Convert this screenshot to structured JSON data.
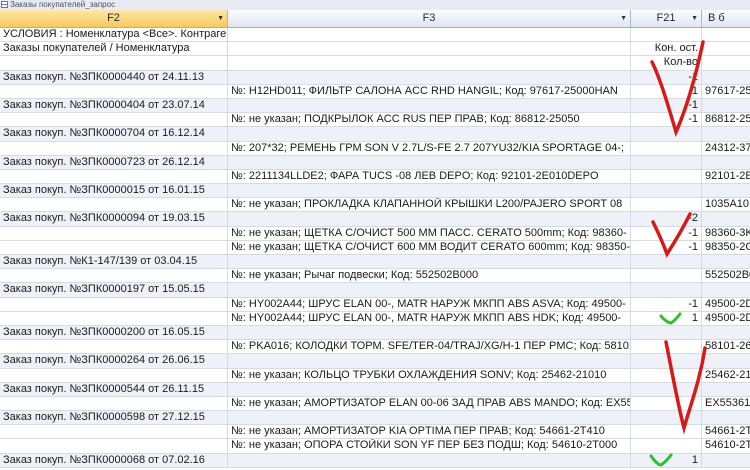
{
  "window": {
    "title": "Заказы покупателей_запрос"
  },
  "columns": [
    {
      "key": "f2",
      "label": "F2",
      "has_dropdown": true
    },
    {
      "key": "f3",
      "label": "F3",
      "has_dropdown": true
    },
    {
      "key": "f21",
      "label": "F21",
      "has_dropdown": true
    },
    {
      "key": "f6",
      "label": "В б",
      "has_dropdown": false
    }
  ],
  "rows": [
    {
      "f2": "УСЛОВИЯ : Номенклатура <Все>.   Контрагент <Все>.",
      "f3": "",
      "f21": "",
      "f6": ""
    },
    {
      "f2": "Заказы покупателей / Номенклатура",
      "f3": "",
      "f21": "Кон. ост.",
      "f6": ""
    },
    {
      "f2": "",
      "f3": "",
      "f21": "Кол-во",
      "f6": ""
    },
    {
      "f2": "Заказ покуп. №ЗПК0000440 от 24.11.13",
      "f3": "",
      "f21": "-1",
      "f6": ""
    },
    {
      "f2": "",
      "f3": "№: H12HD011;   ФИЛЬТР САЛОНА ACC RHD HANGIL;   Код: 97617-25000HAN",
      "f21": "-1",
      "f6": "97617-25"
    },
    {
      "f2": "Заказ покуп. №ЗПК0000404 от 23.07.14",
      "f3": "",
      "f21": "-1",
      "f6": ""
    },
    {
      "f2": "",
      "f3": "№: не указан;   ПОДКРЫЛОК ACC RUS ПЕР ПРАВ;   Код: 86812-25050",
      "f21": "-1",
      "f6": "86812-25"
    },
    {
      "f2": "Заказ покуп. №ЗПК0000704 от 16.12.14",
      "f3": "",
      "f21": "",
      "f6": ""
    },
    {
      "f2": "",
      "f3": "№: 207*32;   РЕМЕНЬ ГРМ SON V 2.7L/S-FE 2.7 207YU32/KIA SPORTAGE 04-;",
      "f21": "",
      "f6": "24312-37"
    },
    {
      "f2": "Заказ покуп. №ЗПК0000723 от 26.12.14",
      "f3": "",
      "f21": "",
      "f6": ""
    },
    {
      "f2": "",
      "f3": "№: 2211134LLDE2;   ФАРА TUCS -08 ЛЕВ DEPO;   Код: 92101-2E010DEPO",
      "f21": "",
      "f6": "92101-2E"
    },
    {
      "f2": "Заказ покуп. №ЗПК0000015 от 16.01.15",
      "f3": "",
      "f21": "",
      "f6": ""
    },
    {
      "f2": "",
      "f3": "№: не указан;   ПРОКЛАДКА КЛАПАННОЙ КРЫШКИ L200/PAJERO SPORT 08",
      "f21": "",
      "f6": "1035A10"
    },
    {
      "f2": "Заказ покуп. №ЗПК0000094 от 19.03.15",
      "f3": "",
      "f21": "-2",
      "f6": ""
    },
    {
      "f2": "",
      "f3": "№: не указан;   ЩЕТКА С/ОЧИСТ 500 ММ ПАСС. CERATO 500mm;   Код: 98360-",
      "f21": "-1",
      "f6": "98360-3K"
    },
    {
      "f2": "",
      "f3": "№: не указан;   ЩЕТКА С/ОЧИСТ 600 ММ ВОДИТ CERATO 600mm;   Код: 98350-",
      "f21": "-1",
      "f6": "98350-2G"
    },
    {
      "f2": "Заказ покуп. №К1-147/139 от 03.04.15",
      "f3": "",
      "f21": "",
      "f6": ""
    },
    {
      "f2": "",
      "f3": "№: не указан;   Рычаг подвески;   Код: 552502B000",
      "f21": "",
      "f6": "552502B0"
    },
    {
      "f2": "Заказ покуп. №ЗПК0000197 от 15.05.15",
      "f3": "",
      "f21": "",
      "f6": ""
    },
    {
      "f2": "",
      "f3": "№: HY002A44;   ШРУС ELAN 00-, MATR НАРУЖ МКПП ABS ASVA;   Код: 49500-",
      "f21": "-1",
      "f6": "49500-2D"
    },
    {
      "f2": "",
      "f3": "№: HY002A44;   ШРУС ELAN 00-, MATR НАРУЖ МКПП ABS HDK;   Код: 49500-",
      "f21": "1",
      "f6": "49500-2D"
    },
    {
      "f2": "Заказ покуп. №ЗПК0000200 от 16.05.15",
      "f3": "",
      "f21": "",
      "f6": ""
    },
    {
      "f2": "",
      "f3": "№: PKA016;   КОЛОДКИ ТОРМ. SFE/TER-04/TRAJ/XG/H-1 ПЕР PMC;   Код: 58101-",
      "f21": "",
      "f6": "58101-26"
    },
    {
      "f2": "Заказ покуп. №ЗПК0000264 от 26.06.15",
      "f3": "",
      "f21": "",
      "f6": ""
    },
    {
      "f2": "",
      "f3": "№: не указан;   КОЛЬЦО ТРУБКИ ОХЛАЖДЕНИЯ SONV;   Код: 25462-21010",
      "f21": "",
      "f6": "25462-21"
    },
    {
      "f2": "Заказ покуп. №ЗПК0000544 от 26.11.15",
      "f3": "",
      "f21": "",
      "f6": ""
    },
    {
      "f2": "",
      "f3": "№: не указан;   АМОРТИЗАТОР ELAN 00-06 ЗАД ПРАВ ABS MANDO;   Код: EX55361-",
      "f21": "",
      "f6": "EX55361-"
    },
    {
      "f2": "Заказ покуп. №ЗПК0000598 от 27.12.15",
      "f3": "",
      "f21": "",
      "f6": ""
    },
    {
      "f2": "",
      "f3": "№: не указан;   АМОРТИЗАТОР KIA OPTIMA ПЕР ПРАВ;   Код: 54661-2T410",
      "f21": "",
      "f6": "54661-2T"
    },
    {
      "f2": "",
      "f3": "№: не указан;   ОПОРА СТОЙКИ SON YF ПЕР БЕЗ ПОДШ;   Код: 54610-2T000",
      "f21": "",
      "f6": "54610-2T"
    },
    {
      "f2": "Заказ покуп. №ЗПК0000068 от 07.02.16",
      "f3": "",
      "f21": "1",
      "f6": ""
    }
  ],
  "annotations": {
    "red_color": "#d61a1a",
    "green_color": "#2fbf2f"
  }
}
